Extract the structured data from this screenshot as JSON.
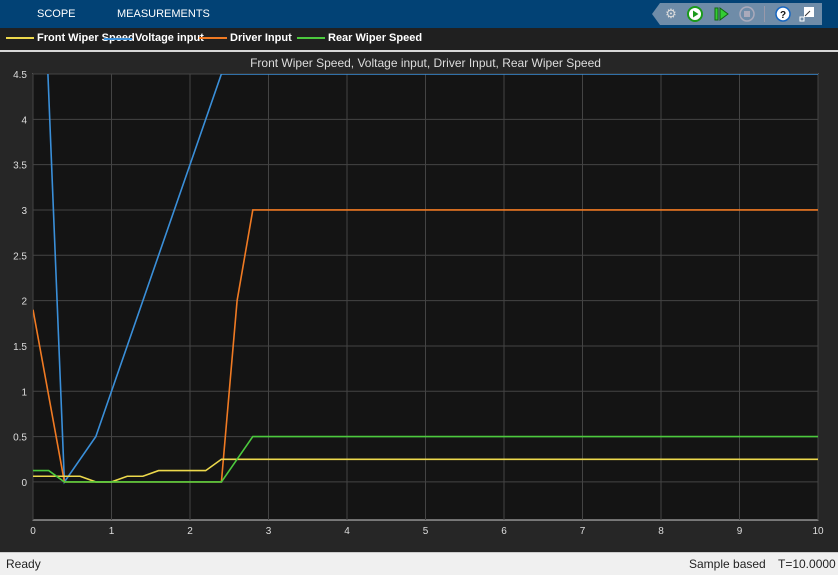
{
  "toolbar": {
    "tabs": [
      "SCOPE",
      "MEASUREMENTS"
    ],
    "icons": [
      "settings-icon",
      "run-icon",
      "step-forward-icon",
      "stop-icon",
      "help-icon",
      "undock-icon"
    ]
  },
  "legend": [
    {
      "label": "Front Wiper Speed",
      "color": "#edd94c"
    },
    {
      "label": "Voltage input",
      "color": "#3a8fd9"
    },
    {
      "label": "Driver Input",
      "color": "#f07a23"
    },
    {
      "label": "Rear Wiper Speed",
      "color": "#4cc93e"
    }
  ],
  "chart_data": {
    "type": "line",
    "title": "Front Wiper Speed, Voltage input, Driver Input, Rear Wiper Speed",
    "xlim": [
      0,
      10
    ],
    "ylim": [
      -0.42,
      4.5
    ],
    "xticks": [
      "0",
      "1",
      "2",
      "3",
      "4",
      "5",
      "6",
      "7",
      "8",
      "9",
      "10"
    ],
    "yticks": [
      "0",
      "0.5",
      "1",
      "1.5",
      "2",
      "2.5",
      "3",
      "3.5",
      "4",
      "4.5"
    ],
    "grid": true,
    "series": [
      {
        "name": "Front Wiper Speed",
        "color": "#edd94c",
        "points": [
          [
            0,
            0.0625
          ],
          [
            0.6,
            0.0625
          ],
          [
            0.8,
            0
          ],
          [
            1.0,
            0
          ],
          [
            1.2,
            0.0625
          ],
          [
            1.4,
            0.0625
          ],
          [
            1.6,
            0.125
          ],
          [
            2.2,
            0.125
          ],
          [
            2.4,
            0.25
          ],
          [
            10,
            0.25
          ]
        ]
      },
      {
        "name": "Voltage input",
        "color": "#3a8fd9",
        "points": [
          [
            0.19,
            4.5
          ],
          [
            0.4,
            0
          ],
          [
            0.8,
            0.5
          ],
          [
            2.4,
            4.5
          ],
          [
            10,
            4.5
          ]
        ]
      },
      {
        "name": "Driver Input",
        "color": "#f07a23",
        "points": [
          [
            0,
            1.9
          ],
          [
            0.4,
            0
          ],
          [
            2.4,
            0
          ],
          [
            2.6,
            2
          ],
          [
            2.8,
            3
          ],
          [
            10,
            3
          ]
        ]
      },
      {
        "name": "Rear Wiper Speed",
        "color": "#4cc93e",
        "points": [
          [
            0,
            0.125
          ],
          [
            0.2,
            0.125
          ],
          [
            0.4,
            0
          ],
          [
            2.4,
            0
          ],
          [
            2.8,
            0.5
          ],
          [
            10,
            0.5
          ]
        ]
      }
    ]
  },
  "status": {
    "left": "Ready",
    "mode": "Sample based",
    "time": "T=10.0000"
  }
}
